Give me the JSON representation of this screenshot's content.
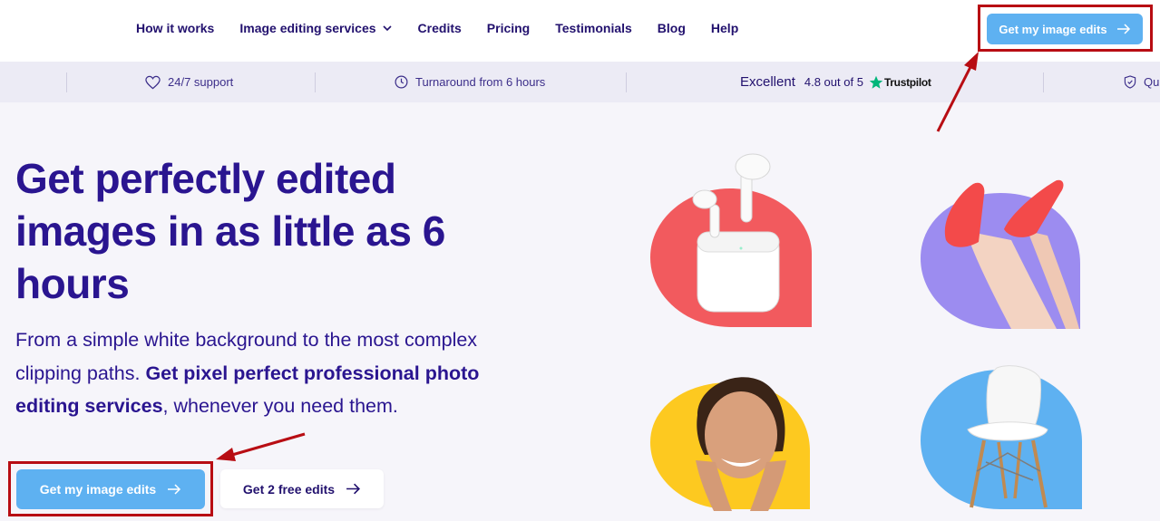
{
  "nav": {
    "links": [
      {
        "label": "How it works"
      },
      {
        "label": "Image editing services",
        "dropdown": true
      },
      {
        "label": "Credits"
      },
      {
        "label": "Pricing"
      },
      {
        "label": "Testimonials"
      },
      {
        "label": "Blog"
      },
      {
        "label": "Help"
      }
    ],
    "cta_label": "Get my image edits"
  },
  "trust_bar": {
    "support": "24/7 support",
    "turnaround": "Turnaround from 6 hours",
    "rating_word": "Excellent",
    "rating_score": "4.8 out of 5",
    "rating_brand": "Trustpilot",
    "quality_partial": "Qu"
  },
  "hero": {
    "title": "Get perfectly edited images in as little as 6 hours",
    "subtitle_plain_1": "From a simple white background to the most complex clipping paths. ",
    "subtitle_bold": "Get pixel perfect professional photo editing services",
    "subtitle_plain_2": ", whenever you need them.",
    "primary_cta": "Get my image edits",
    "secondary_cta": "Get 2 free edits"
  },
  "colors": {
    "brand_text": "#2a1590",
    "cta_blue": "#5eb1f1",
    "annotation_red": "#b80d13",
    "tile_red": "#f25a5e",
    "tile_purple": "#9c8cf0",
    "tile_yellow": "#fdc920",
    "tile_blue": "#5eb1f1",
    "trustpilot_green": "#00b67a"
  },
  "icons": [
    "heart-icon",
    "clock-icon",
    "star-icon",
    "shield-icon",
    "chevron-down-icon",
    "arrow-right-icon"
  ]
}
